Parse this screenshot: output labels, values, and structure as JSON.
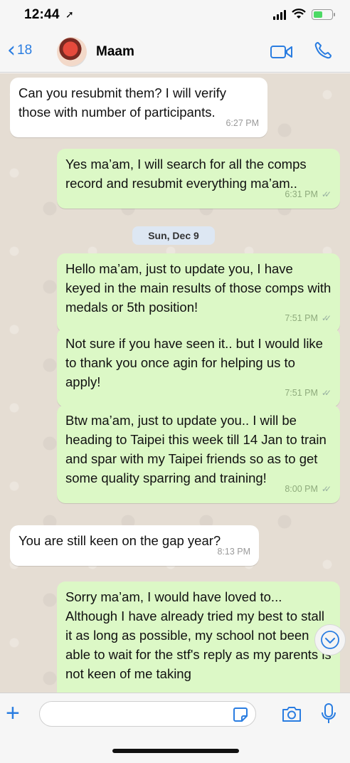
{
  "status_bar": {
    "time": "12:44",
    "location_icon": "location-arrow-icon"
  },
  "nav": {
    "back_count": "18",
    "contact_name": "Maam"
  },
  "messages": [
    {
      "dir": "in",
      "text": "Can you resubmit them? I will verify those with number of participants.",
      "time": "6:27 PM"
    },
    {
      "dir": "out",
      "text": "Yes ma’am, I will search for all the comps record and resubmit everything ma’am..",
      "time": "6:31 PM"
    },
    {
      "dir": "out",
      "text": "Hello ma’am, just to update you, I have keyed in the main results of those comps with medals or 5th position!",
      "time": "7:51 PM"
    },
    {
      "dir": "out",
      "text": "Not sure if you have seen it.. but I would like to thank you once agin for  helping us to apply!",
      "time": "7:51 PM"
    },
    {
      "dir": "out",
      "text": "Btw ma’am, just to update you.. I will be heading to Taipei this week till 14 Jan to train and spar with my Taipei friends so as to get some quality sparring and training!",
      "time": "8:00 PM"
    },
    {
      "dir": "in",
      "text": "You are still keen on the gap year?",
      "time": "8:13 PM"
    },
    {
      "dir": "out",
      "text": "Sorry ma’am, I would have loved to... Although I have already tried my best to stall it as long as possible, my school not been able to wait for the stf's reply as my parents is not keen of me taking",
      "time": ""
    }
  ],
  "date_separator": "Sun, Dec 9",
  "input": {
    "value": "",
    "placeholder": ""
  },
  "colors": {
    "accent": "#2a7de1",
    "outgoing_bubble": "#dcf8c6",
    "incoming_bubble": "#ffffff",
    "chat_bg": "#e5ddd3"
  }
}
